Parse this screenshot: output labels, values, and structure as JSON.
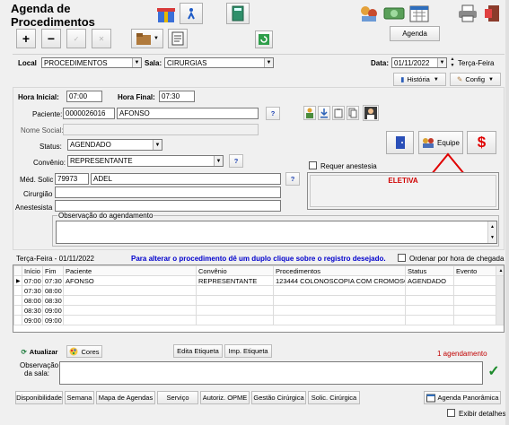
{
  "app": {
    "title": "Agenda de Procedimentos"
  },
  "toolbar": {
    "agenda_button": "Agenda"
  },
  "filter": {
    "local_label": "Local",
    "local_value": "PROCEDIMENTOS",
    "sala_label": "Sala:",
    "sala_value": "CIRURGIAS",
    "data_label": "Data:",
    "data_value": "01/11/2022",
    "weekday": "Terça-Feira",
    "historia_label": "História",
    "config_label": "Config"
  },
  "form": {
    "hora_inicial_label": "Hora Inicial:",
    "hora_inicial_value": "07:00",
    "hora_final_label": "Hora Final:",
    "hora_final_value": "07:30",
    "paciente_label": "Paciente:",
    "paciente_code": "0000026016",
    "paciente_name": "AFONSO",
    "help_mark": "?",
    "nome_social_label": "Nome Social:",
    "status_label": "Status:",
    "status_value": "AGENDADO",
    "convenio_label": "Convênio:",
    "convenio_value": "REPRESENTANTE",
    "med_solic_label": "Méd. Solic",
    "med_solic_code": "79973",
    "med_solic_name": "ADEL",
    "cirurgiao_label": "Cirurgião",
    "anestesista_label": "Anestesista",
    "requer_anestesia_label": "Requer anestesia",
    "eletiva_label": "ELETIVA",
    "observacao_label": "Observação do agendamento",
    "equipe_label": "Equipe",
    "dollar_label": "$"
  },
  "list": {
    "date_header": "Terça-Feira - 01/11/2022",
    "instruction": "Para alterar o procedimento dê um duplo clique sobre o registro desejado.",
    "ordenar_label": "Ordenar por hora de chegada",
    "columns": [
      "Início",
      "Fim",
      "Paciente",
      "Convênio",
      "Procedimentos",
      "Status",
      "Evento"
    ],
    "rows": [
      [
        "07:00",
        "07:30",
        "AFONSO",
        "REPRESENTANTE",
        "123444 COLONOSCOPIA COM CROMOSCOPIA",
        "AGENDADO",
        ""
      ],
      [
        "07:30",
        "08:00",
        "",
        "",
        "",
        "",
        ""
      ],
      [
        "08:00",
        "08:30",
        "",
        "",
        "",
        "",
        ""
      ],
      [
        "08:30",
        "09:00",
        "",
        "",
        "",
        "",
        ""
      ],
      [
        "09:00",
        "09:00",
        "",
        "",
        "",
        "",
        ""
      ]
    ]
  },
  "bottom": {
    "atualizar_label": "Atualizar",
    "cores_label": "Cores",
    "edita_etiqueta_label": "Edita Etiqueta",
    "imp_etiqueta_label": "Imp. Etiqueta",
    "count_text": "1 agendamento",
    "obs_sala_label_1": "Observação",
    "obs_sala_label_2": "da sala:",
    "exibir_detalhes_label": "Exibir detalhes"
  },
  "nav": {
    "tabs": [
      "Disponibilidade",
      "Semana",
      "Mapa de Agendas",
      "Serviço",
      "Autoriz. OPME",
      "Gestão Cirúrgica",
      "Solic. Cirúrgica"
    ],
    "panoramica_label": "Agenda Panorâmica"
  },
  "colors": {
    "count_red": "#c00000",
    "instruction_blue": "#0000cc",
    "arrow_red": "#e00000"
  }
}
